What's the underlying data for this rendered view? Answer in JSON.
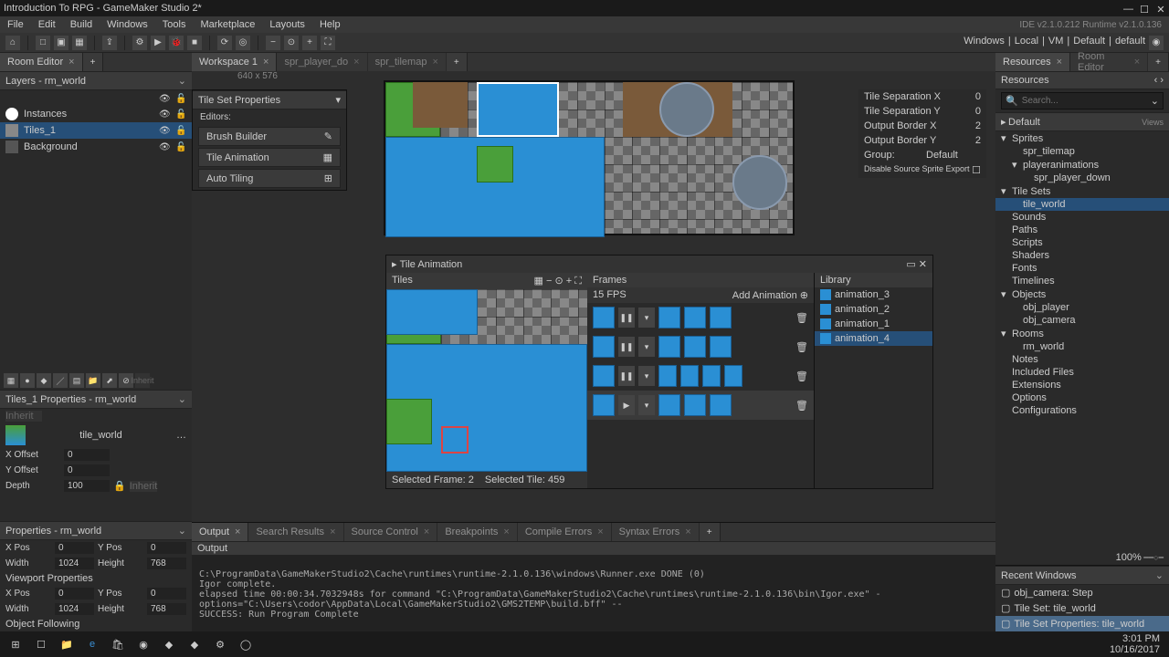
{
  "title": "Introduction To RPG - GameMaker Studio 2*",
  "ide_info": "IDE v2.1.0.212 Runtime v2.1.0.136",
  "menus": [
    "File",
    "Edit",
    "Build",
    "Windows",
    "Tools",
    "Marketplace",
    "Layouts",
    "Help"
  ],
  "toolbar_right": [
    "Windows",
    "Local",
    "VM",
    "Default",
    "default"
  ],
  "room_editor": {
    "tab": "Room Editor",
    "layers_hdr": "Layers - rm_world",
    "layers": [
      "Instances",
      "Tiles_1",
      "Background"
    ]
  },
  "layer_tools_hdr": "Tiles_1 Properties - rm_world",
  "tile_name": "tile_world",
  "layer_props": [
    [
      "X Offset",
      "0"
    ],
    [
      "Y Offset",
      "0"
    ],
    [
      "Depth",
      "100"
    ]
  ],
  "room_props_hdr": "Properties - rm_world",
  "room_props": [
    [
      "X Pos",
      "0",
      "Y Pos",
      "0"
    ],
    [
      "Width",
      "1024",
      "Height",
      "768"
    ]
  ],
  "viewport_hdr": "Viewport Properties",
  "viewport_props": [
    [
      "X Pos",
      "0",
      "Y Pos",
      "0"
    ],
    [
      "Width",
      "1024",
      "Height",
      "768"
    ]
  ],
  "obj_following": "Object Following",
  "workspace": {
    "tab": "Workspace 1",
    "dim": "640 x 576",
    "extra_tabs": [
      "",
      "spr_player_do",
      "spr_tilemap"
    ]
  },
  "tileset_props": {
    "hdr": "Tile Set Properties",
    "editors": "Editors:",
    "btns": [
      "Brush Builder",
      "Tile Animation",
      "Auto Tiling"
    ]
  },
  "tileset_info": {
    "rows": [
      [
        "Tile Separation X",
        "0"
      ],
      [
        "Tile Separation Y",
        "0"
      ],
      [
        "Output Border X",
        "2"
      ],
      [
        "Output Border Y",
        "2"
      ]
    ],
    "group_lbl": "Group:",
    "group_val": "Default",
    "disable_export": "Disable Source Sprite Export"
  },
  "tile_anim": {
    "hdr": "Tile Animation",
    "tiles_lbl": "Tiles",
    "frames_lbl": "Frames",
    "fps_val": "15",
    "fps_lbl": "FPS",
    "add_anim": "Add Animation",
    "library_lbl": "Library",
    "lib_items": [
      "animation_3",
      "animation_2",
      "animation_1",
      "animation_4"
    ],
    "sel_frame": "Selected Frame: 2",
    "sel_tile": "Selected Tile: 459"
  },
  "output": {
    "tabs": [
      "Output",
      "Search Results",
      "Source Control",
      "Breakpoints",
      "Compile Errors",
      "Syntax Errors"
    ],
    "hdr": "Output",
    "lines": [
      "C:\\ProgramData\\GameMakerStudio2\\Cache\\runtimes\\runtime-2.1.0.136\\windows\\Runner.exe DONE (0)",
      "Igor complete.",
      "elapsed time 00:00:34.7032948s for command \"C:\\ProgramData\\GameMakerStudio2\\Cache\\runtimes\\runtime-2.1.0.136\\bin\\Igor.exe\" -options=\"C:\\Users\\codor\\AppData\\Local\\GameMakerStudio2\\GMS2TEMP\\build.bff\" --",
      "SUCCESS: Run Program Complete"
    ]
  },
  "resources": {
    "tab": "Resources",
    "tab2": "Room Editor",
    "hdr": "Resources",
    "search_ph": "Search...",
    "default": "Default",
    "views": "Views",
    "tree": [
      {
        "lbl": "Sprites",
        "exp": true,
        "children": [
          {
            "lbl": "spr_tilemap"
          },
          {
            "lbl": "playeranimations",
            "exp": true,
            "children": [
              {
                "lbl": "spr_player_down"
              }
            ]
          }
        ]
      },
      {
        "lbl": "Tile Sets",
        "exp": true,
        "children": [
          {
            "lbl": "tile_world",
            "sel": true
          }
        ]
      },
      {
        "lbl": "Sounds"
      },
      {
        "lbl": "Paths"
      },
      {
        "lbl": "Scripts"
      },
      {
        "lbl": "Shaders"
      },
      {
        "lbl": "Fonts"
      },
      {
        "lbl": "Timelines"
      },
      {
        "lbl": "Objects",
        "exp": true,
        "children": [
          {
            "lbl": "obj_player"
          },
          {
            "lbl": "obj_camera"
          }
        ]
      },
      {
        "lbl": "Rooms",
        "exp": true,
        "children": [
          {
            "lbl": "rm_world"
          }
        ]
      },
      {
        "lbl": "Notes"
      },
      {
        "lbl": "Included Files"
      },
      {
        "lbl": "Extensions"
      },
      {
        "lbl": "Options"
      },
      {
        "lbl": "Configurations"
      }
    ]
  },
  "recent": {
    "hdr": "Recent Windows",
    "items": [
      "obj_camera: Step",
      "Tile Set: tile_world",
      "Tile Set Properties: tile_world"
    ]
  },
  "zoom": "100%",
  "clock": {
    "time": "3:01 PM",
    "date": "10/16/2017"
  }
}
